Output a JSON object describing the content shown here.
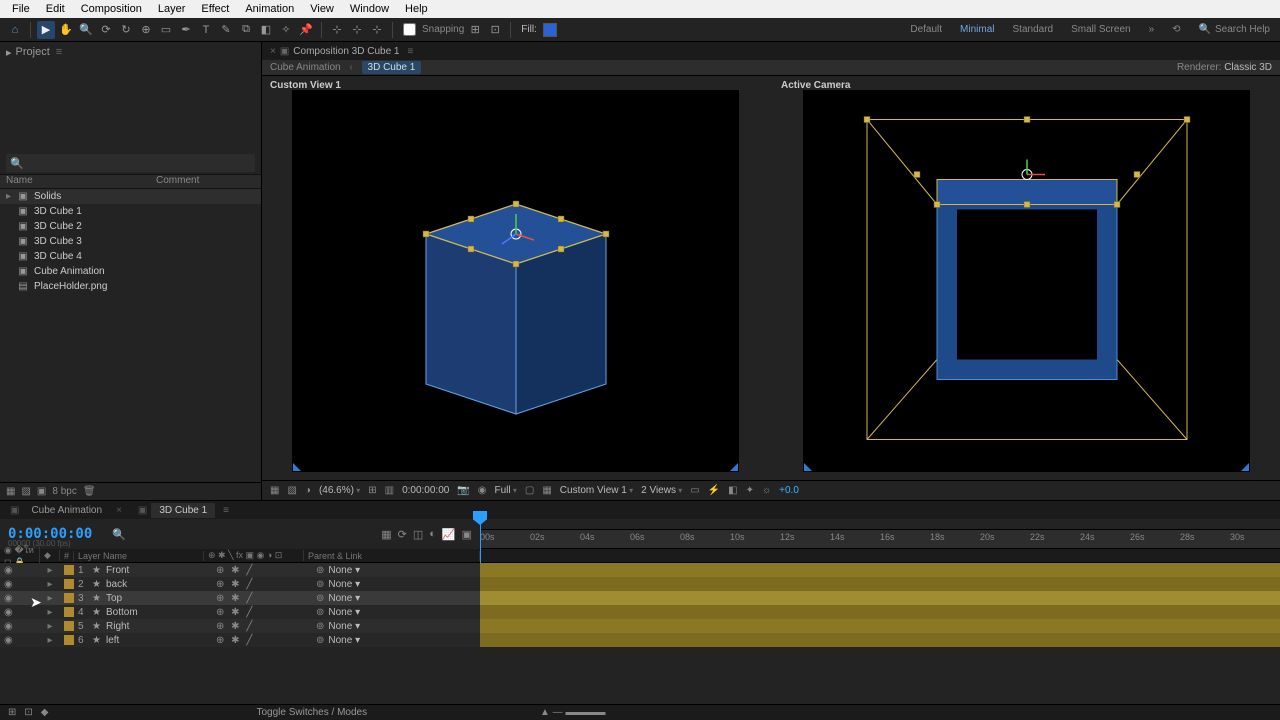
{
  "menubar": [
    "File",
    "Edit",
    "Composition",
    "Layer",
    "Effect",
    "Animation",
    "View",
    "Window",
    "Help"
  ],
  "toolbar": {
    "snapping_label": "Snapping",
    "fill_label": "Fill:",
    "workspaces": {
      "default": "Default",
      "minimal": "Minimal",
      "standard": "Standard",
      "small": "Small Screen"
    },
    "search_placeholder": "Search Help"
  },
  "project": {
    "panel_title": "Project",
    "cols": {
      "name": "Name",
      "comment": "Comment"
    },
    "items": [
      {
        "type": "folder",
        "label": "Solids"
      },
      {
        "type": "comp",
        "label": "3D Cube 1"
      },
      {
        "type": "comp",
        "label": "3D Cube 2"
      },
      {
        "type": "comp",
        "label": "3D Cube 3"
      },
      {
        "type": "comp",
        "label": "3D Cube 4"
      },
      {
        "type": "comp",
        "label": "Cube Animation"
      },
      {
        "type": "img",
        "label": "PlaceHolder.png"
      }
    ],
    "footer_bpc": "8 bpc"
  },
  "comp": {
    "tab_label": "Composition 3D Cube 1",
    "crumb_parent": "Cube Animation",
    "crumb_current": "3D Cube 1",
    "renderer_label": "Renderer:",
    "renderer_value": "Classic 3D",
    "view_left": "Custom View 1",
    "view_right": "Active Camera",
    "footer": {
      "zoom": "(46.6%)",
      "timecode": "0:00:00:00",
      "resolution": "Full",
      "view_sel": "Custom View 1",
      "views": "2 Views",
      "exposure": "+0.0"
    }
  },
  "timeline": {
    "tab_anim": "Cube Animation",
    "tab_cube": "3D Cube 1",
    "timecode": "0:00:00:00",
    "timecode_sub": "00000 (30.00 fps)",
    "col_layer": "Layer Name",
    "col_parent": "Parent & Link",
    "layers": [
      {
        "n": 1,
        "name": "Front",
        "parent": "None"
      },
      {
        "n": 2,
        "name": "back",
        "parent": "None"
      },
      {
        "n": 3,
        "name": "Top",
        "parent": "None",
        "sel": true
      },
      {
        "n": 4,
        "name": "Bottom",
        "parent": "None"
      },
      {
        "n": 5,
        "name": "Right",
        "parent": "None"
      },
      {
        "n": 6,
        "name": "left",
        "parent": "None"
      }
    ],
    "ruler": [
      "00s",
      "02s",
      "04s",
      "06s",
      "08s",
      "10s",
      "12s",
      "14s",
      "16s",
      "18s",
      "20s",
      "22s",
      "24s",
      "26s",
      "28s",
      "30s"
    ],
    "footer_toggle": "Toggle Switches / Modes"
  }
}
